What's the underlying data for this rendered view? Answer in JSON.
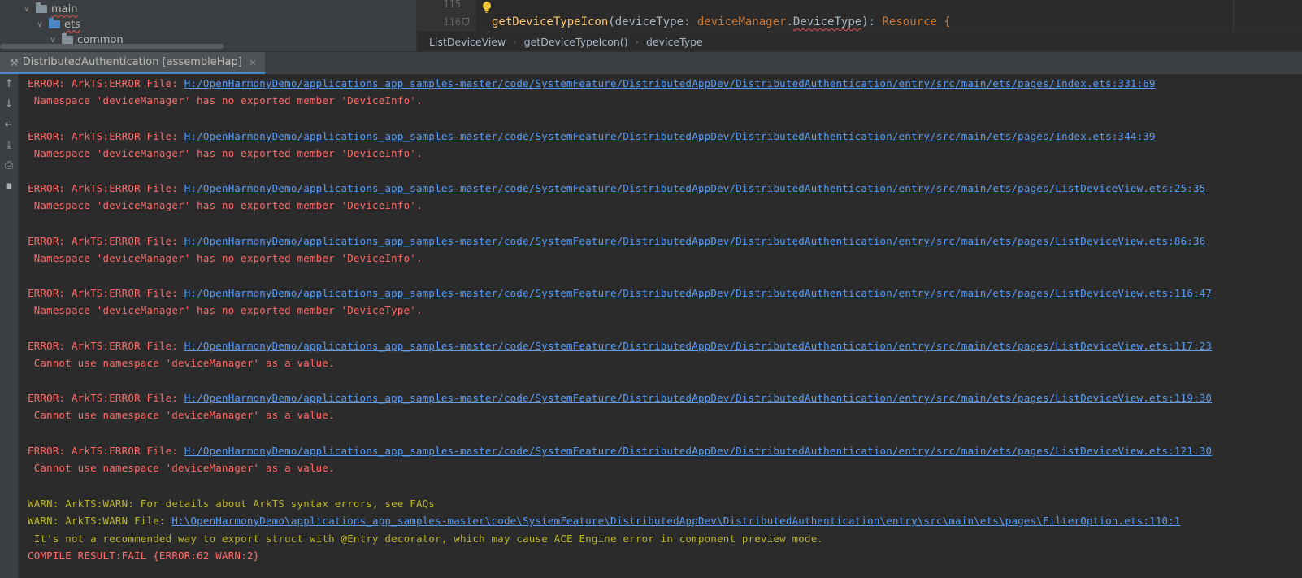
{
  "project_tree": {
    "items": [
      {
        "label": "main",
        "icon": "folder-icon",
        "squiggle": true
      },
      {
        "label": "ets",
        "icon": "folder-blue-icon",
        "squiggle": true
      },
      {
        "label": "common",
        "icon": "folder-icon",
        "squiggle": false
      }
    ]
  },
  "editor": {
    "lines": [
      {
        "number": "115"
      },
      {
        "number": "116"
      }
    ],
    "code": {
      "fn": "getDeviceTypeIcon",
      "open": "(",
      "param": "deviceType",
      "colon": ": ",
      "ns": "deviceManager",
      "dot": ".",
      "type": "DeviceType",
      "close": "): ",
      "ret": "Resource",
      "brace": " {"
    }
  },
  "breadcrumb": [
    "ListDeviceView",
    "getDeviceTypeIcon()",
    "deviceType"
  ],
  "run_tab": {
    "label": "DistributedAuthentication [assembleHap]",
    "close": "×"
  },
  "toolbar_icons": [
    "arrow-up-icon",
    "arrow-down-icon",
    "soft-wrap-icon",
    "scroll-to-end-icon",
    "print-icon",
    "trash-icon"
  ],
  "console": {
    "lines": [
      {
        "type": "error",
        "prefix": "ERROR: ArkTS:ERROR File: ",
        "link": "H:/OpenHarmonyDemo/applications_app_samples-master/code/SystemFeature/DistributedAppDev/DistributedAuthentication/entry/src/main/ets/pages/Index.ets:331:69"
      },
      {
        "type": "error",
        "text": " Namespace 'deviceManager' has no exported member 'DeviceInfo'."
      },
      {
        "type": "error",
        "prefix": "ERROR: ArkTS:ERROR File: ",
        "link": "H:/OpenHarmonyDemo/applications_app_samples-master/code/SystemFeature/DistributedAppDev/DistributedAuthentication/entry/src/main/ets/pages/Index.ets:344:39"
      },
      {
        "type": "error",
        "text": " Namespace 'deviceManager' has no exported member 'DeviceInfo'."
      },
      {
        "type": "error",
        "prefix": "ERROR: ArkTS:ERROR File: ",
        "link": "H:/OpenHarmonyDemo/applications_app_samples-master/code/SystemFeature/DistributedAppDev/DistributedAuthentication/entry/src/main/ets/pages/ListDeviceView.ets:25:35"
      },
      {
        "type": "error",
        "text": " Namespace 'deviceManager' has no exported member 'DeviceInfo'."
      },
      {
        "type": "error",
        "prefix": "ERROR: ArkTS:ERROR File: ",
        "link": "H:/OpenHarmonyDemo/applications_app_samples-master/code/SystemFeature/DistributedAppDev/DistributedAuthentication/entry/src/main/ets/pages/ListDeviceView.ets:86:36"
      },
      {
        "type": "error",
        "text": " Namespace 'deviceManager' has no exported member 'DeviceInfo'."
      },
      {
        "type": "error",
        "prefix": "ERROR: ArkTS:ERROR File: ",
        "link": "H:/OpenHarmonyDemo/applications_app_samples-master/code/SystemFeature/DistributedAppDev/DistributedAuthentication/entry/src/main/ets/pages/ListDeviceView.ets:116:47"
      },
      {
        "type": "error",
        "text": " Namespace 'deviceManager' has no exported member 'DeviceType'."
      },
      {
        "type": "error",
        "prefix": "ERROR: ArkTS:ERROR File: ",
        "link": "H:/OpenHarmonyDemo/applications_app_samples-master/code/SystemFeature/DistributedAppDev/DistributedAuthentication/entry/src/main/ets/pages/ListDeviceView.ets:117:23"
      },
      {
        "type": "error",
        "text": " Cannot use namespace 'deviceManager' as a value."
      },
      {
        "type": "error",
        "prefix": "ERROR: ArkTS:ERROR File: ",
        "link": "H:/OpenHarmonyDemo/applications_app_samples-master/code/SystemFeature/DistributedAppDev/DistributedAuthentication/entry/src/main/ets/pages/ListDeviceView.ets:119:30"
      },
      {
        "type": "error",
        "text": " Cannot use namespace 'deviceManager' as a value."
      },
      {
        "type": "error",
        "prefix": "ERROR: ArkTS:ERROR File: ",
        "link": "H:/OpenHarmonyDemo/applications_app_samples-master/code/SystemFeature/DistributedAppDev/DistributedAuthentication/entry/src/main/ets/pages/ListDeviceView.ets:121:30"
      },
      {
        "type": "error",
        "text": " Cannot use namespace 'deviceManager' as a value."
      },
      {
        "type": "warn",
        "text": "WARN: ArkTS:WARN: For details about ArkTS syntax errors, see FAQs"
      },
      {
        "type": "warn",
        "prefix": "WARN: ArkTS:WARN File: ",
        "link": "H:\\OpenHarmonyDemo\\applications_app_samples-master\\code\\SystemFeature\\DistributedAppDev\\DistributedAuthentication\\entry\\src\\main\\ets\\pages\\FilterOption.ets:110:1"
      },
      {
        "type": "warn",
        "text": " It's not a recommended way to export struct with @Entry decorator, which may cause ACE Engine error in component preview mode."
      },
      {
        "type": "error",
        "text": "COMPILE RESULT:FAIL {ERROR:62 WARN:2}"
      }
    ]
  },
  "colors": {
    "error": "#ff6b68",
    "warn": "#bbb529",
    "link": "#589df6",
    "background": "#2b2b2b"
  }
}
